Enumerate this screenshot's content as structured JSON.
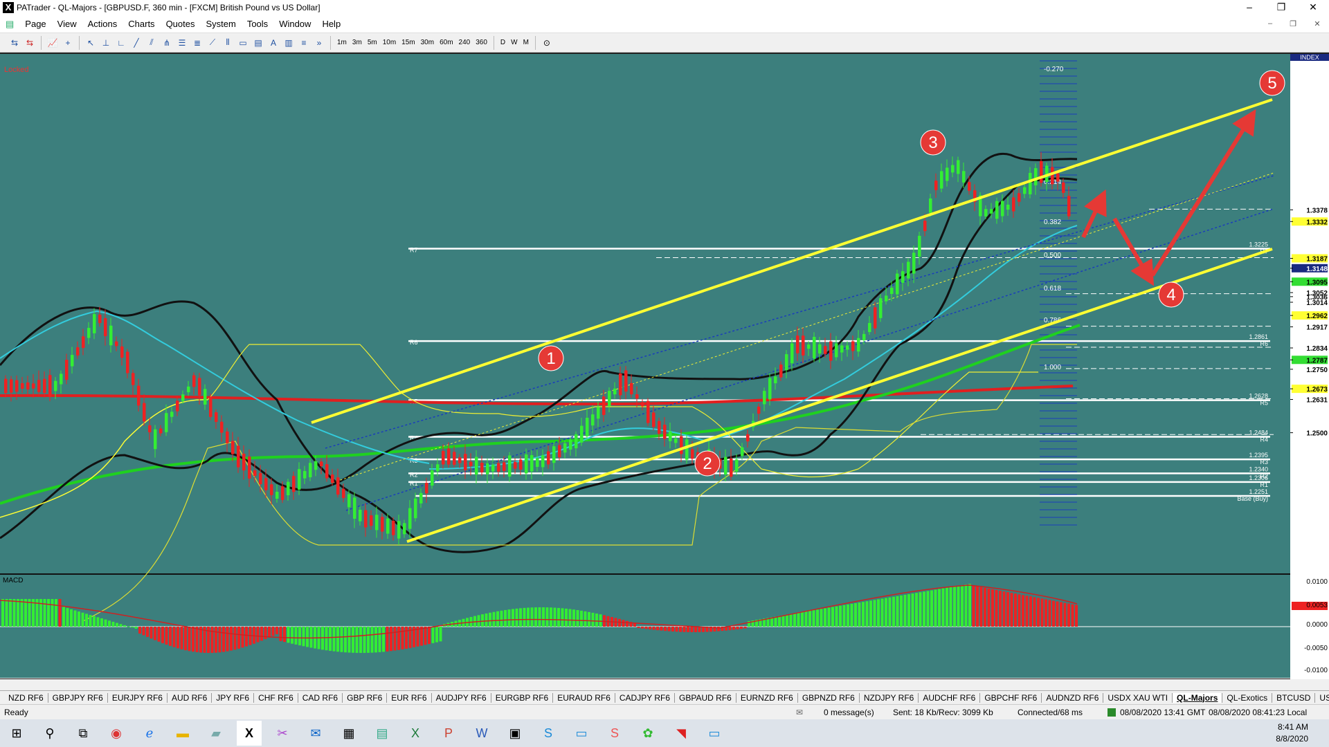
{
  "window": {
    "title": "PATrader - QL-Majors - [GBPUSD.F, 360 min - [FXCM] British Pound vs US Dollar]",
    "controls": [
      "–",
      "❐",
      "✕"
    ]
  },
  "menu": [
    "Page",
    "View",
    "Actions",
    "Charts",
    "Quotes",
    "System",
    "Tools",
    "Window",
    "Help"
  ],
  "timeframes": [
    "1m",
    "3m",
    "5m",
    "10m",
    "15m",
    "30m",
    "60m",
    "240",
    "360",
    "D",
    "W",
    "M"
  ],
  "chart": {
    "locked_label": "Locked",
    "index_label": "INDEX",
    "macd_label": "MACD",
    "price_axis": [
      {
        "v": 1.3378
      },
      {
        "v": 1.3332,
        "bg": "#ffff33"
      },
      {
        "v": 1.3187,
        "bg": "#ffff33"
      },
      {
        "v": 1.3148,
        "bg": "#1a2a80",
        "fg": "#ffffff"
      },
      {
        "v": 1.3095,
        "bg": "#33dd33"
      },
      {
        "v": 1.3052
      },
      {
        "v": 1.3036
      },
      {
        "v": 1.3014
      },
      {
        "v": 1.2962,
        "bg": "#ffff33"
      },
      {
        "v": 1.2917
      },
      {
        "v": 1.2834
      },
      {
        "v": 1.2787,
        "bg": "#33dd33"
      },
      {
        "v": 1.275
      },
      {
        "v": 1.2673,
        "bg": "#ffff33"
      },
      {
        "v": 1.2631
      },
      {
        "v": 1.25
      }
    ],
    "macd_axis": [
      "0.0100",
      "0.0053",
      "0.0000",
      "-0.0050",
      "-0.0100"
    ],
    "fib_labels": [
      "-0.270",
      "0.214",
      "0.382",
      "0.500",
      "0.618",
      "0.786",
      "1.000"
    ],
    "pivot_labels": [
      {
        "left": "R7",
        "right": "1.3225",
        "sub": "R7"
      },
      {
        "left": "R6",
        "right": "1.2861",
        "sub": "R6"
      },
      {
        "left": "R5",
        "right": "1.2628",
        "sub": "R5"
      },
      {
        "left": "R4",
        "right": "1.2484",
        "sub": "R4"
      },
      {
        "left": "R3",
        "right": "1.2395",
        "sub": "R3"
      },
      {
        "left": "R2",
        "right": "1.2340",
        "sub": "R2"
      },
      {
        "left": "R1",
        "right": "1.2306",
        "sub": "R1"
      },
      {
        "left": "",
        "right": "1.2251",
        "sub": "Base (Buy)"
      }
    ],
    "wave_markers": [
      "1",
      "2",
      "3",
      "4",
      "5"
    ]
  },
  "symbol_tabs": [
    "NZD RF6",
    "GBPJPY RF6",
    "EURJPY RF6",
    "AUD RF6",
    "JPY RF6",
    "CHF RF6",
    "CAD RF6",
    "GBP RF6",
    "EUR RF6",
    "AUDJPY RF6",
    "EURGBP RF6",
    "EURAUD RF6",
    "CADJPY RF6",
    "GBPAUD RF6",
    "EURNZD RF6",
    "GBPNZD RF6",
    "NZDJPY RF6",
    "AUDCHF RF6",
    "GBPCHF RF6",
    "AUDNZD RF6",
    "USDX XAU WTI",
    "QL-Majors",
    "QL-Exotics",
    "BTCUSD",
    "USDX RF6"
  ],
  "active_tab": "QL-Majors",
  "status": {
    "ready": "Ready",
    "messages": "0 message(s)",
    "traffic": "Sent: 18 Kb/Recv: 3099 Kb",
    "connection": "Connected/68 ms",
    "server_time": "08/08/2020 13:41 GMT",
    "local_time": "08/08/2020 08:41:23 Local"
  },
  "tray": {
    "time": "8:41 AM",
    "date": "8/8/2020"
  },
  "colors": {
    "chart_bg": "#3c7f7d",
    "bull": "#33ee33",
    "bear": "#ee2222",
    "channel": "#ffff33",
    "marker": "#e53935"
  }
}
